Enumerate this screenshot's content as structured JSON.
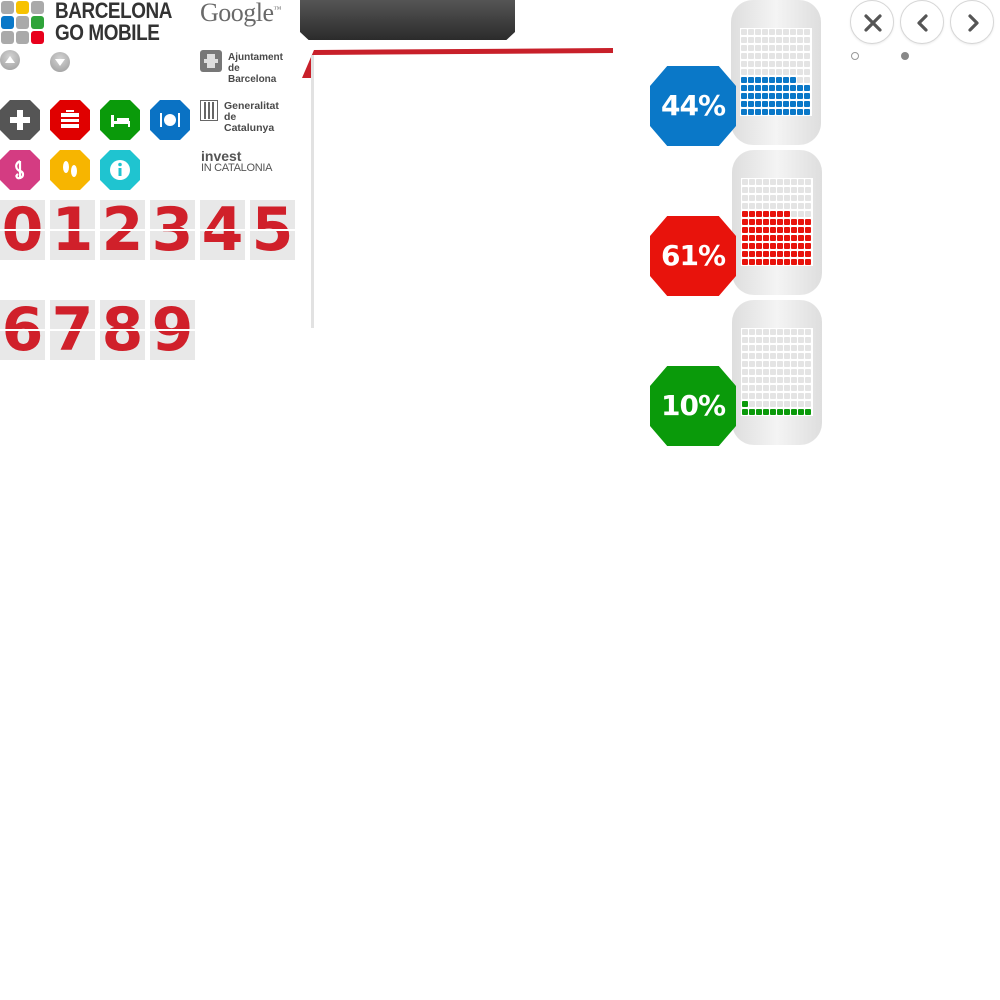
{
  "brand": {
    "logo_line1": "BARCELONA",
    "logo_line2": "GO MOBILE",
    "logo_colors": [
      "#aaaaaa",
      "#f7c200",
      "#aaaaaa",
      "#0a78c8",
      "#aaaaaa",
      "#2fa43a",
      "#aaaaaa",
      "#aaaaaa",
      "#e8001c"
    ]
  },
  "scroll_controls": {
    "up_icon": "up-arrow-icon",
    "down_icon": "down-arrow-icon"
  },
  "categories": [
    {
      "name": "plus",
      "icon": "plus-icon",
      "color": "#555555"
    },
    {
      "name": "shopping",
      "icon": "shopping-icon",
      "color": "#e00000"
    },
    {
      "name": "accommodation",
      "icon": "bed-icon",
      "color": "#0a9a0a"
    },
    {
      "name": "restaurants",
      "icon": "restaurant-icon",
      "color": "#0a72c4"
    },
    {
      "name": "music",
      "icon": "music-icon",
      "color": "#d43c82"
    },
    {
      "name": "walking",
      "icon": "footprints-icon",
      "color": "#f7b500"
    },
    {
      "name": "info",
      "icon": "info-icon",
      "color": "#1fc4d0"
    }
  ],
  "digits_row1": [
    "0",
    "1",
    "2",
    "3",
    "4",
    "5"
  ],
  "digits_row2": [
    "6",
    "7",
    "8",
    "9"
  ],
  "sponsors": {
    "google": "Google",
    "ajuntament_line1": "Ajuntament",
    "ajuntament_line2": "de Barcelona",
    "generalitat_line1": "Generalitat",
    "generalitat_line2": "de Catalunya",
    "invest_line1": "invest",
    "invest_line2": "IN CATALONIA"
  },
  "stats": [
    {
      "label": "44%",
      "percent": 44,
      "color": "#0a78c8"
    },
    {
      "label": "61%",
      "percent": 61,
      "color": "#e8130c"
    },
    {
      "label": "10%",
      "percent": 10,
      "color": "#0a9a0a"
    }
  ],
  "accent_red": "#c8202a",
  "navigation": {
    "close_icon": "close-icon",
    "prev_icon": "chevron-left-icon",
    "next_icon": "chevron-right-icon"
  },
  "pager": {
    "active_index": 1,
    "count": 2
  }
}
